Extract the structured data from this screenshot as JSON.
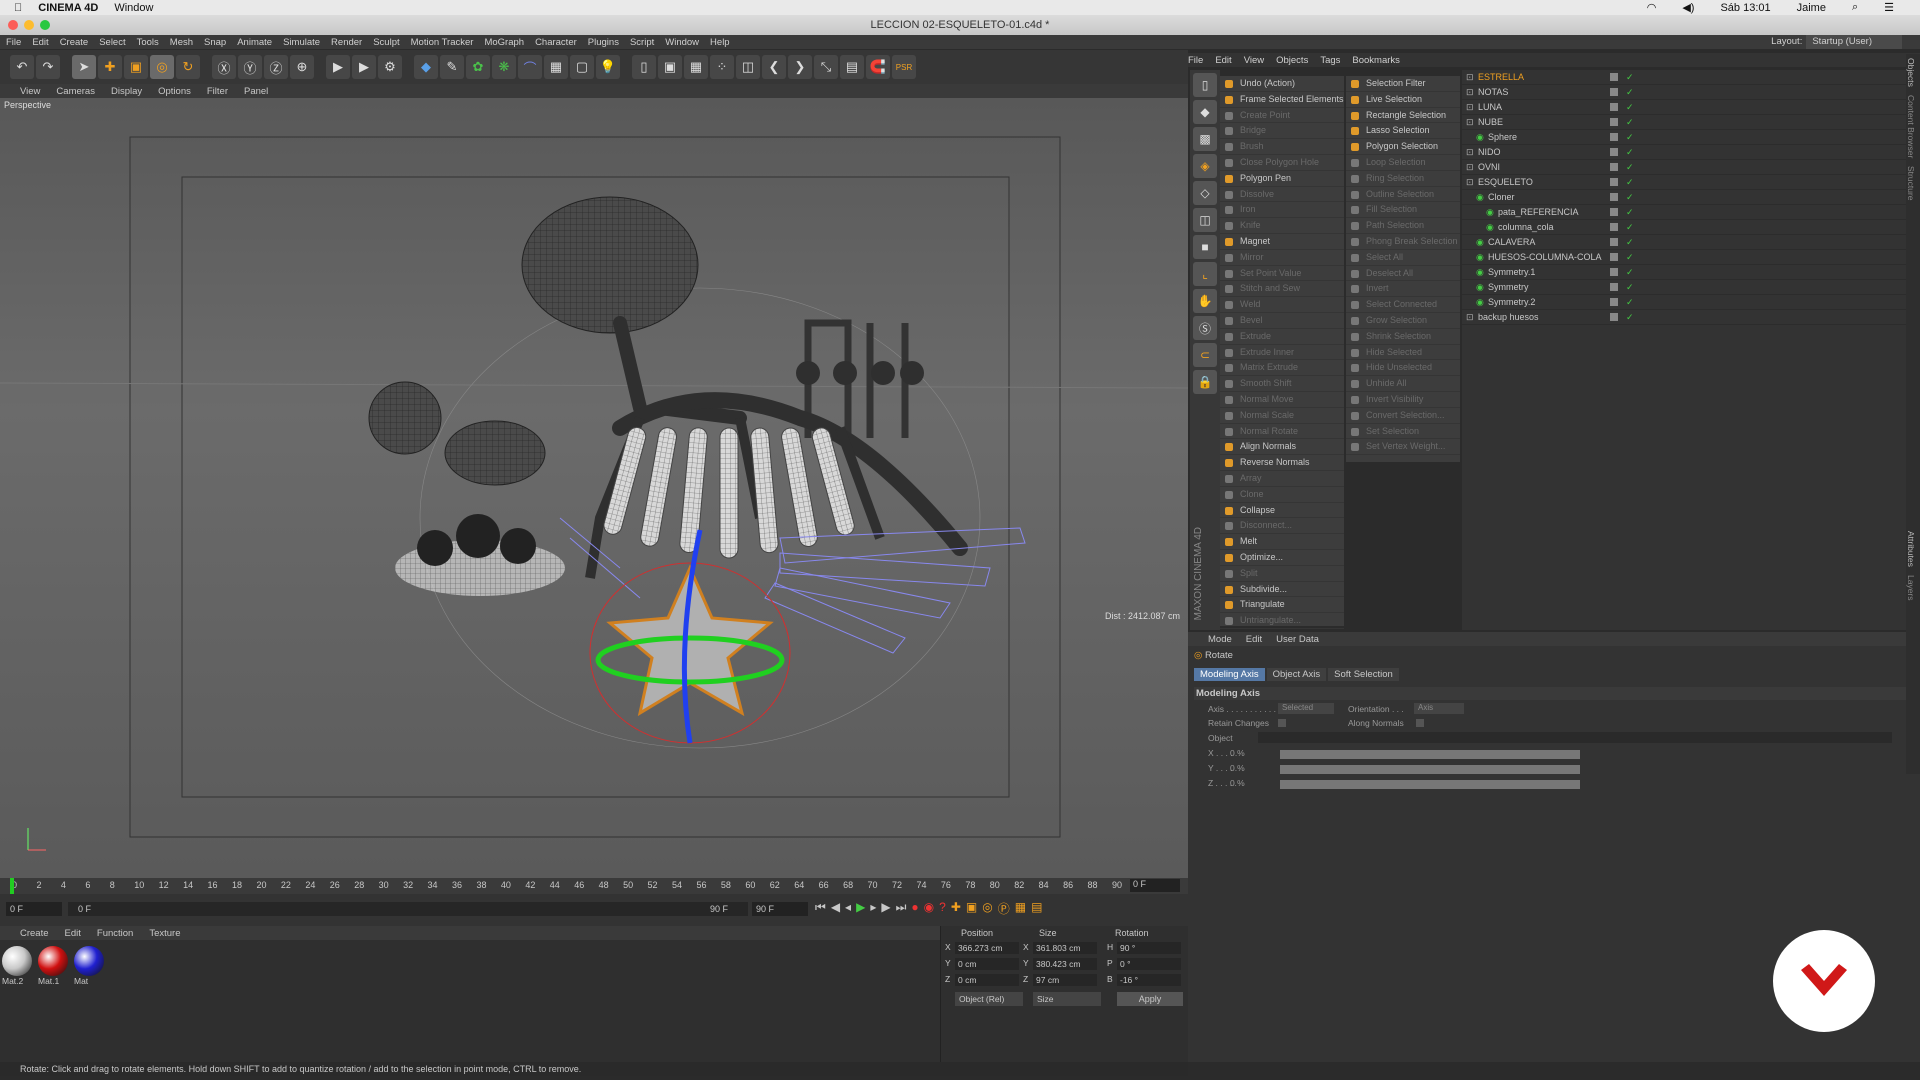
{
  "mac": {
    "app": "CINEMA 4D",
    "window": "Window",
    "clock": "Sáb 13:01",
    "user": "Jaime"
  },
  "title": "LECCION 02-ESQUELETO-01.c4d *",
  "menu": [
    "File",
    "Edit",
    "Create",
    "Select",
    "Tools",
    "Mesh",
    "Snap",
    "Animate",
    "Simulate",
    "Render",
    "Sculpt",
    "Motion Tracker",
    "MoGraph",
    "Character",
    "Plugins",
    "Script",
    "Window",
    "Help"
  ],
  "layout": {
    "label": "Layout:",
    "value": "Startup (User)"
  },
  "objmenu": [
    "File",
    "Edit",
    "View",
    "Objects",
    "Tags",
    "Bookmarks"
  ],
  "vpmenu": [
    "View",
    "Cameras",
    "Display",
    "Options",
    "Filter",
    "Panel"
  ],
  "viewport": {
    "label": "Perspective",
    "dist": "Dist : 2412.087 cm"
  },
  "cmd1": [
    {
      "t": "Undo (Action)",
      "s": "on"
    },
    {
      "t": "Frame Selected Elements",
      "s": "on"
    },
    {
      "t": "Create Point",
      "s": "off"
    },
    {
      "t": "Bridge",
      "s": "off"
    },
    {
      "t": "Brush",
      "s": "off"
    },
    {
      "t": "Close Polygon Hole",
      "s": "off"
    },
    {
      "t": "Polygon Pen",
      "s": "on"
    },
    {
      "t": "Dissolve",
      "s": "off"
    },
    {
      "t": "Iron",
      "s": "off"
    },
    {
      "t": "Knife",
      "s": "off"
    },
    {
      "t": "Magnet",
      "s": "on"
    },
    {
      "t": "Mirror",
      "s": "off"
    },
    {
      "t": "Set Point Value",
      "s": "off"
    },
    {
      "t": "Stitch and Sew",
      "s": "off"
    },
    {
      "t": "Weld",
      "s": "off"
    },
    {
      "t": "Bevel",
      "s": "off"
    },
    {
      "t": "Extrude",
      "s": "off"
    },
    {
      "t": "Extrude Inner",
      "s": "off"
    },
    {
      "t": "Matrix Extrude",
      "s": "off"
    },
    {
      "t": "Smooth Shift",
      "s": "off"
    },
    {
      "t": "Normal Move",
      "s": "off"
    },
    {
      "t": "Normal Scale",
      "s": "off"
    },
    {
      "t": "Normal Rotate",
      "s": "off"
    },
    {
      "t": "Align Normals",
      "s": "on"
    },
    {
      "t": "Reverse Normals",
      "s": "on"
    },
    {
      "t": "Array",
      "s": "off"
    },
    {
      "t": "Clone",
      "s": "off"
    },
    {
      "t": "Collapse",
      "s": "on"
    },
    {
      "t": "Disconnect...",
      "s": "off"
    },
    {
      "t": "Melt",
      "s": "on"
    },
    {
      "t": "Optimize...",
      "s": "on"
    },
    {
      "t": "Split",
      "s": "off"
    },
    {
      "t": "Subdivide...",
      "s": "on"
    },
    {
      "t": "Triangulate",
      "s": "on"
    },
    {
      "t": "Untriangulate...",
      "s": "off"
    }
  ],
  "cmd2": [
    {
      "t": "Selection Filter",
      "s": "on"
    },
    {
      "t": "Live Selection",
      "s": "on"
    },
    {
      "t": "Rectangle Selection",
      "s": "on"
    },
    {
      "t": "Lasso Selection",
      "s": "on"
    },
    {
      "t": "Polygon Selection",
      "s": "on"
    },
    {
      "t": "Loop Selection",
      "s": "off"
    },
    {
      "t": "Ring Selection",
      "s": "off"
    },
    {
      "t": "Outline Selection",
      "s": "off"
    },
    {
      "t": "Fill Selection",
      "s": "off"
    },
    {
      "t": "Path Selection",
      "s": "off"
    },
    {
      "t": "Phong Break Selection",
      "s": "off"
    },
    {
      "t": "Select All",
      "s": "off"
    },
    {
      "t": "Deselect All",
      "s": "off"
    },
    {
      "t": "Invert",
      "s": "off"
    },
    {
      "t": "Select Connected",
      "s": "off"
    },
    {
      "t": "Grow Selection",
      "s": "off"
    },
    {
      "t": "Shrink Selection",
      "s": "off"
    },
    {
      "t": "Hide Selected",
      "s": "off"
    },
    {
      "t": "Hide Unselected",
      "s": "off"
    },
    {
      "t": "Unhide All",
      "s": "off"
    },
    {
      "t": "Invert Visibility",
      "s": "off"
    },
    {
      "t": "Convert Selection...",
      "s": "off"
    },
    {
      "t": "Set Selection",
      "s": "off"
    },
    {
      "t": "Set Vertex Weight...",
      "s": "off"
    }
  ],
  "objects": [
    {
      "n": "ESTRELLA",
      "i": 0,
      "hl": true
    },
    {
      "n": "NOTAS",
      "i": 0
    },
    {
      "n": "LUNA",
      "i": 0
    },
    {
      "n": "NUBE",
      "i": 0
    },
    {
      "n": "Sphere",
      "i": 1
    },
    {
      "n": "NIDO",
      "i": 0
    },
    {
      "n": "OVNI",
      "i": 0
    },
    {
      "n": "ESQUELETO",
      "i": 0
    },
    {
      "n": "Cloner",
      "i": 1
    },
    {
      "n": "pata_REFERENCIA",
      "i": 2
    },
    {
      "n": "columna_cola",
      "i": 2
    },
    {
      "n": "CALAVERA",
      "i": 1
    },
    {
      "n": "HUESOS-COLUMNA-COLA",
      "i": 1
    },
    {
      "n": "Symmetry.1",
      "i": 1
    },
    {
      "n": "Symmetry",
      "i": 1
    },
    {
      "n": "Symmetry.2",
      "i": 1
    },
    {
      "n": "backup huesos",
      "i": 0
    }
  ],
  "attr": {
    "menu": [
      "Mode",
      "Edit",
      "User Data"
    ],
    "tool": "Rotate",
    "tabs": [
      "Modeling Axis",
      "Object Axis",
      "Soft Selection"
    ],
    "section": "Modeling Axis",
    "axis_label": "Axis . . . . . . . . . . .",
    "axis_val": "Selected",
    "orient_label": "Orientation . . .",
    "orient_val": "Axis",
    "retain": "Retain Changes",
    "along": "Along Normals",
    "object": "Object",
    "x": "X . . . . .",
    "y": "Y . . . . .",
    "z": "Z . . . . .",
    "pct": "0 %"
  },
  "timeline": {
    "ticks": [
      "0",
      "2",
      "4",
      "6",
      "8",
      "10",
      "12",
      "14",
      "16",
      "18",
      "20",
      "22",
      "24",
      "26",
      "28",
      "30",
      "32",
      "34",
      "36",
      "38",
      "40",
      "42",
      "44",
      "46",
      "48",
      "50",
      "52",
      "54",
      "56",
      "58",
      "60",
      "62",
      "64",
      "66",
      "68",
      "70",
      "72",
      "74",
      "76",
      "78",
      "80",
      "82",
      "84",
      "86",
      "88",
      "90"
    ],
    "end": "0 F",
    "start": "0 F",
    "frame": "0 F",
    "f90": "90 F",
    "f90b": "90 F"
  },
  "matmenu": [
    "Create",
    "Edit",
    "Function",
    "Texture"
  ],
  "materials": [
    {
      "n": "Mat.2",
      "c": "#c8c8c8"
    },
    {
      "n": "Mat.1",
      "c": "#d01010"
    },
    {
      "n": "Mat",
      "c": "#2020d0"
    }
  ],
  "coord": {
    "h_pos": "Position",
    "h_size": "Size",
    "h_rot": "Rotation",
    "rows": [
      {
        "a": "X",
        "p": "366.273 cm",
        "b": "X",
        "s": "361.803 cm",
        "c": "H",
        "r": "90 °"
      },
      {
        "a": "Y",
        "p": "0 cm",
        "b": "Y",
        "s": "380.423 cm",
        "c": "P",
        "r": "0 °"
      },
      {
        "a": "Z",
        "p": "0 cm",
        "b": "Z",
        "s": "97 cm",
        "c": "B",
        "r": "-16 °"
      }
    ],
    "mode": "Object (Rel)",
    "sizemode": "Size",
    "apply": "Apply"
  },
  "status": "Rotate: Click and drag to rotate elements. Hold down SHIFT to add to quantize rotation / add to the selection in point mode, CTRL to remove.",
  "side_tabs": [
    "Objects",
    "Content Browser",
    "Structure",
    "Attributes",
    "Layers"
  ]
}
